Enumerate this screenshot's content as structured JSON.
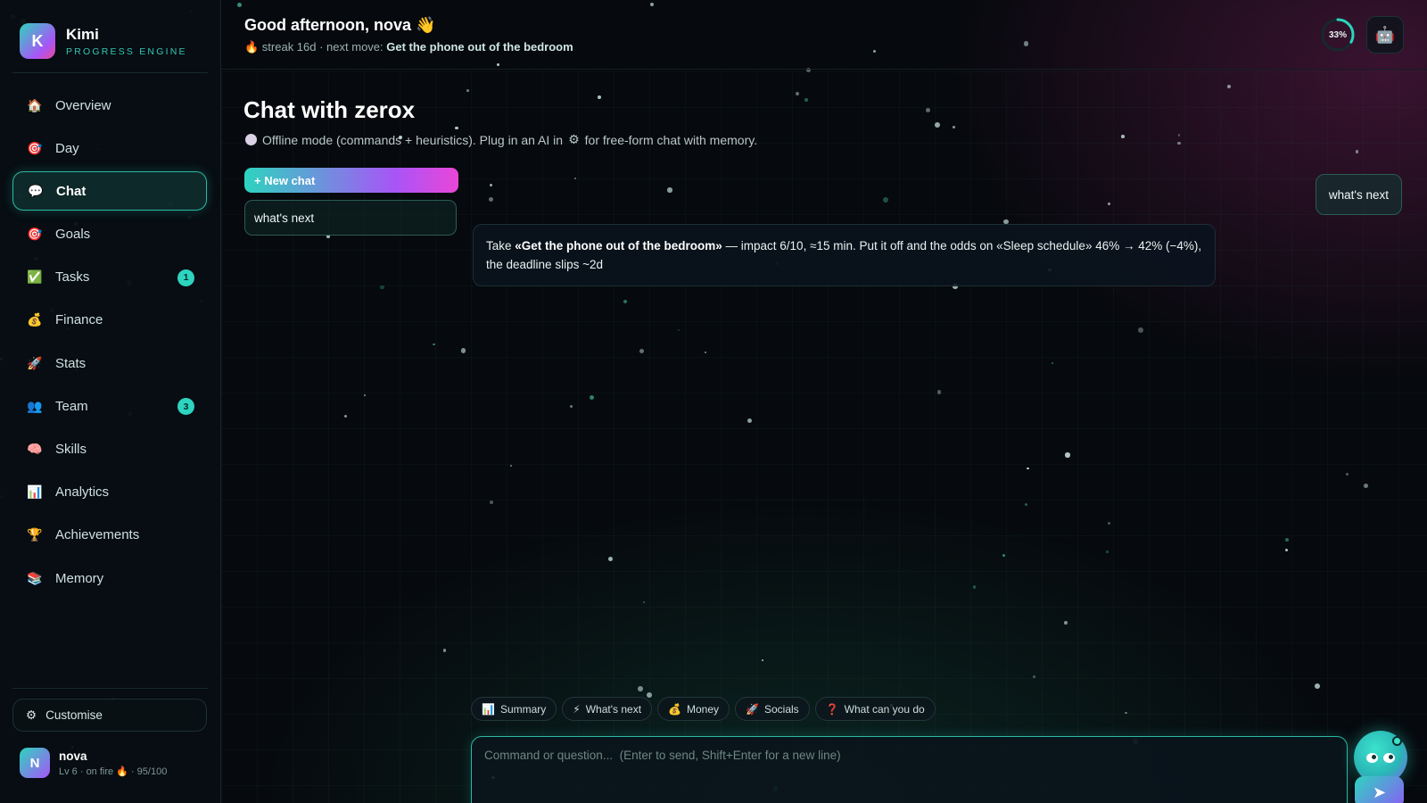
{
  "app": {
    "name": "Kimi",
    "tagline": "PROGRESS ENGINE",
    "logo_letter": "K"
  },
  "sidebar": {
    "items": [
      {
        "label": "Overview",
        "icon": "🏠",
        "icon_name": "house-icon"
      },
      {
        "label": "Day",
        "icon": "🎯",
        "icon_name": "target-icon"
      },
      {
        "label": "Chat",
        "icon": "💬",
        "icon_name": "chat-bubble-icon",
        "active": true
      },
      {
        "label": "Goals",
        "icon": "🎯",
        "icon_name": "target-icon"
      },
      {
        "label": "Tasks",
        "icon": "✅",
        "icon_name": "checkmark-icon",
        "badge": "1"
      },
      {
        "label": "Finance",
        "icon": "💰",
        "icon_name": "money-bag-icon"
      },
      {
        "label": "Stats",
        "icon": "🚀",
        "icon_name": "rocket-icon"
      },
      {
        "label": "Team",
        "icon": "👥",
        "icon_name": "people-icon",
        "badge": "3"
      },
      {
        "label": "Skills",
        "icon": "🧠",
        "icon_name": "brain-icon"
      },
      {
        "label": "Analytics",
        "icon": "📊",
        "icon_name": "bar-chart-icon"
      },
      {
        "label": "Achievements",
        "icon": "🏆",
        "icon_name": "trophy-icon"
      },
      {
        "label": "Memory",
        "icon": "📚",
        "icon_name": "books-icon"
      }
    ],
    "customise": {
      "label": "Customise",
      "icon": "⚙",
      "icon_name": "gear-icon"
    },
    "user": {
      "initial": "N",
      "name": "nova",
      "meta": "Lv 6 · on fire 🔥 · 95/100"
    }
  },
  "header": {
    "greeting": "Good afternoon, nova 👋",
    "streak_prefix": "🔥 streak 16d · next move: ",
    "next_move": "Get the phone out of the bedroom",
    "progress": {
      "value": 33,
      "label": "33%"
    },
    "bot_icon": "🤖"
  },
  "main": {
    "title": "Chat with zerox",
    "subtitle_before": "Offline mode (commands + heuristics). Plug in an AI in",
    "subtitle_after": "for free-form chat with memory.",
    "settings_icon": "⚙",
    "new_chat_label": "+ New chat",
    "chat_list": [
      {
        "title": "what's next"
      }
    ]
  },
  "messages": {
    "user": "what's next",
    "bot_pre": "Take ",
    "bot_bold": "«Get the phone out of the bedroom»",
    "bot_post": " — impact 6/10, ≈15 min. Put it off and the odds on «Sleep schedule» 46% → 42% (−4%), the deadline slips ~2d"
  },
  "quick_actions": [
    {
      "icon": "📊",
      "label": "Summary",
      "icon_name": "bar-chart-icon"
    },
    {
      "icon": "⚡",
      "label": "What's next",
      "icon_name": "lightning-icon"
    },
    {
      "icon": "💰",
      "label": "Money",
      "icon_name": "money-bag-icon"
    },
    {
      "icon": "🚀",
      "label": "Socials",
      "icon_name": "rocket-icon"
    },
    {
      "icon": "❓",
      "label": "What can you do",
      "icon_name": "question-icon"
    }
  ],
  "composer": {
    "placeholder": "Command or question...  (Enter to send, Shift+Enter for a new line)",
    "send_icon": "➤"
  },
  "colors": {
    "accent": "#2dd4bf",
    "accent2": "#a855f7",
    "pink": "#ec4899",
    "bg": "#06090d"
  }
}
